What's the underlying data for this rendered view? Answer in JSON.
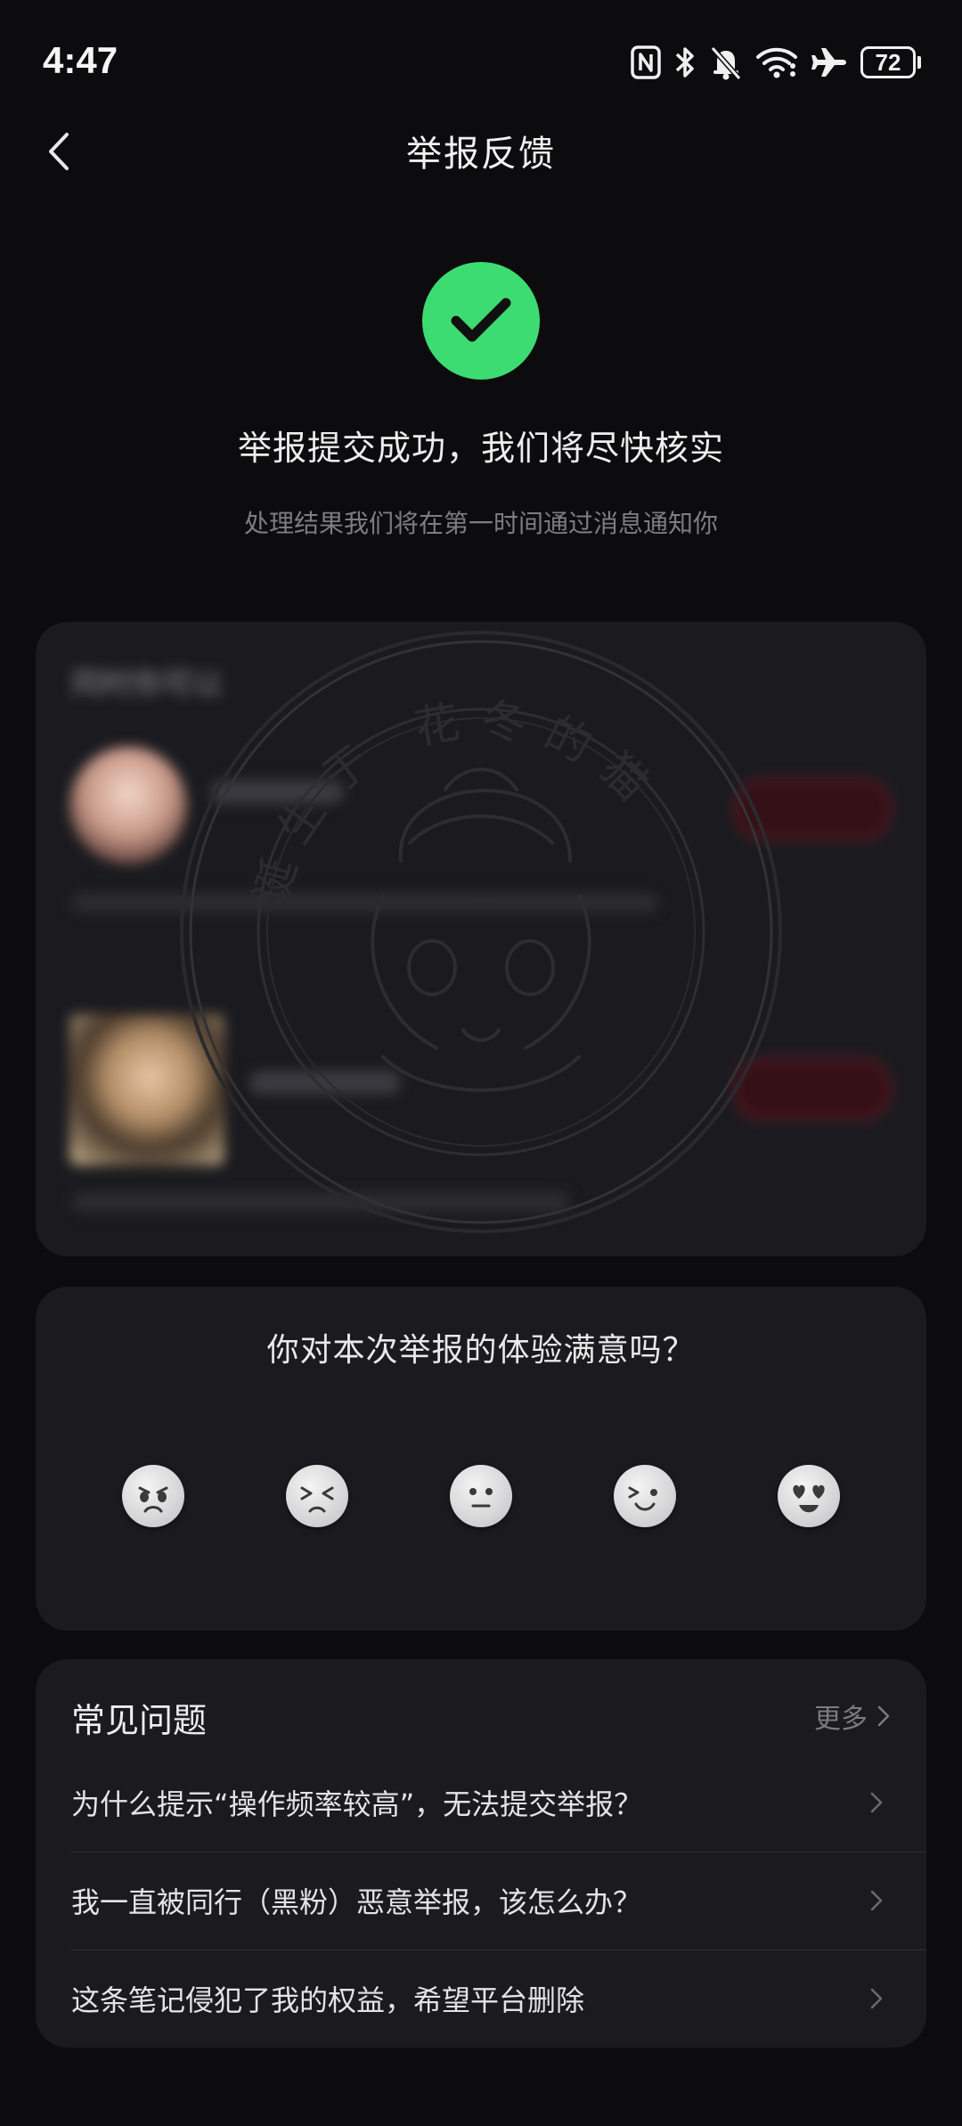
{
  "status_bar": {
    "time": "4:47",
    "icons": [
      "nfc-icon",
      "bluetooth-icon",
      "bell-muted-icon",
      "wifi-icon",
      "airplane-icon"
    ],
    "battery_level": "72"
  },
  "nav": {
    "back_icon": "chevron-left-icon",
    "title": "举报反馈"
  },
  "success": {
    "icon": "check-circle-icon",
    "accent_color": "#3ddc72",
    "title": "举报提交成功，我们将尽快核实",
    "subtitle": "处理结果我们将在第一时间通过消息通知你"
  },
  "recommendations": {
    "heading": "同时你可以"
  },
  "watermark": {
    "seal_text": "诞生于 花冬的猫"
  },
  "rating": {
    "question": "你对本次举报的体验满意吗？",
    "options": [
      {
        "icon": "very-dissatisfied-face-icon"
      },
      {
        "icon": "dissatisfied-face-icon"
      },
      {
        "icon": "neutral-face-icon"
      },
      {
        "icon": "satisfied-face-icon"
      },
      {
        "icon": "very-satisfied-face-icon"
      }
    ]
  },
  "faq": {
    "title": "常见问题",
    "more_label": "更多",
    "items": [
      {
        "text": "为什么提示“操作频率较高”，无法提交举报？"
      },
      {
        "text": "我一直被同行（黑粉）恶意举报，该怎么办？"
      },
      {
        "text": "这条笔记侵犯了我的权益，希望平台删除"
      }
    ]
  }
}
